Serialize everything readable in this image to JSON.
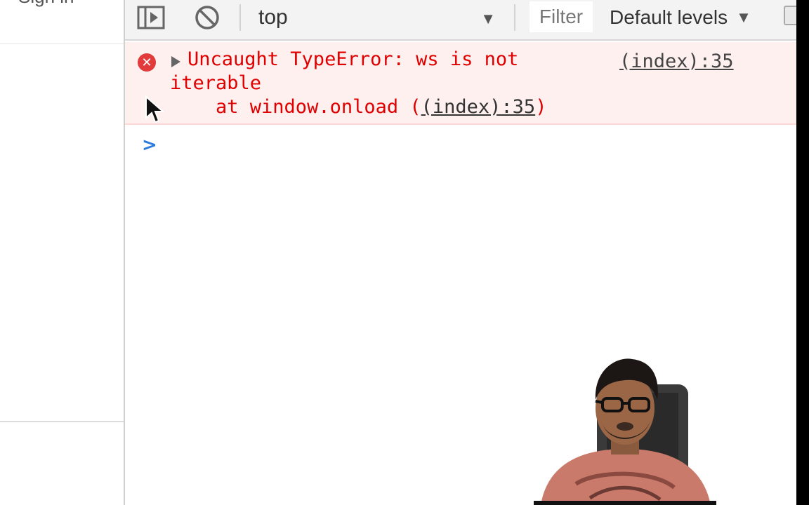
{
  "left_pane": {
    "top_text": "Sign in"
  },
  "toolbar": {
    "sidebar_toggle_icon": "sidebar-toggle-icon",
    "clear_icon": "block-icon",
    "context_value": "top",
    "filter_placeholder": "Filter",
    "levels_label": "Default levels"
  },
  "console": {
    "error": {
      "line1": "Uncaught TypeError: ws is not",
      "line2": "iterable",
      "line3_prefix": "    at window.onload (",
      "line3_link": "(index):35",
      "line3_suffix": ")",
      "source_link": "(index):35"
    },
    "prompt_symbol": ">"
  },
  "colors": {
    "error_text": "#e00000",
    "error_bg": "#fff0f0",
    "error_icon": "#e23b3b",
    "prompt": "#2a7bde",
    "toolbar_bg": "#f3f3f3"
  }
}
